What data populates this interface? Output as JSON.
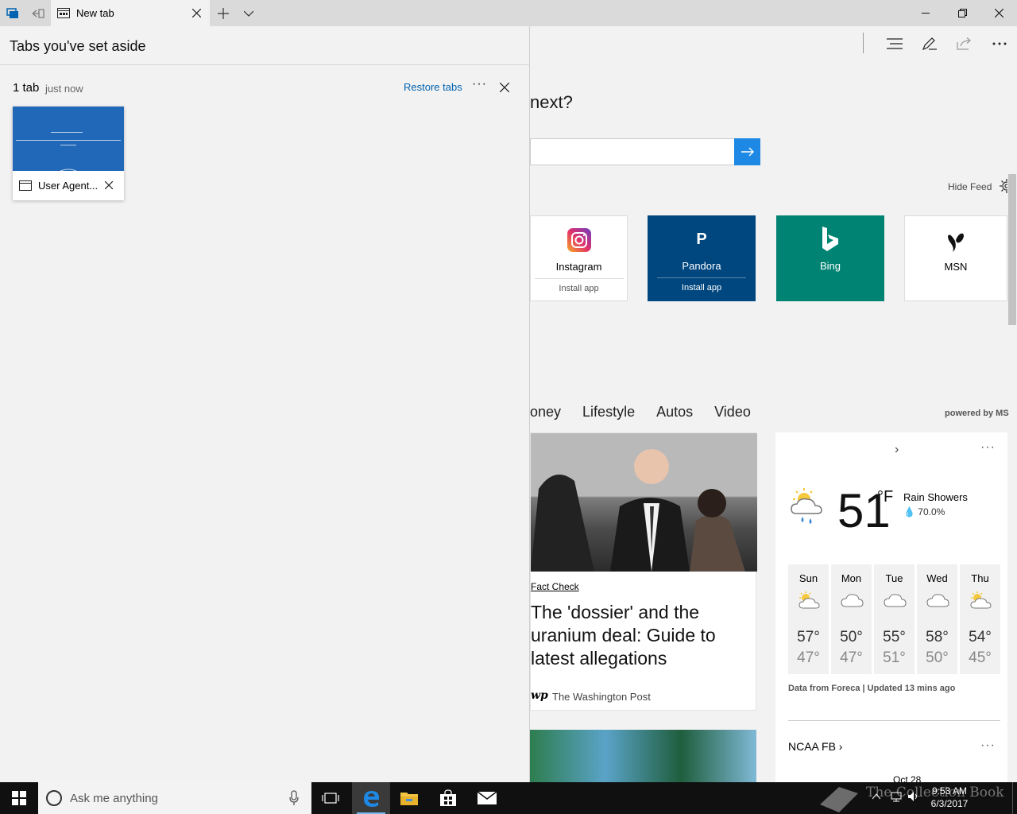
{
  "titlebar": {
    "tab_label": "New tab"
  },
  "toolbar": {
    "icons": [
      "hub-icon",
      "pen-icon",
      "share-icon",
      "more-icon"
    ]
  },
  "page": {
    "headline_fragment": "next?",
    "hide_feed": "Hide Feed",
    "tiles": [
      {
        "name": "Instagram",
        "install": "Install app"
      },
      {
        "name": "Pandora",
        "install": "Install app",
        "logo_text": "P"
      },
      {
        "name": "Bing"
      },
      {
        "name": "MSN"
      }
    ],
    "categories": [
      "oney",
      "Lifestyle",
      "Autos",
      "Video"
    ],
    "powered_by": "powered by MS",
    "news": {
      "tag": "Fact Check",
      "title": "The 'dossier' and the uranium deal: Guide to latest allegations",
      "source": "The Washington Post",
      "source_mark": "wp"
    },
    "weather": {
      "temp": "51",
      "unit": "°F",
      "condition": "Rain Showers",
      "precip": "70.0%",
      "days": [
        {
          "name": "Sun",
          "hi": "57°",
          "lo": "47°",
          "icon": "partly-sunny-icon"
        },
        {
          "name": "Mon",
          "hi": "50°",
          "lo": "47°",
          "icon": "cloud-icon"
        },
        {
          "name": "Tue",
          "hi": "55°",
          "lo": "51°",
          "icon": "cloud-icon"
        },
        {
          "name": "Wed",
          "hi": "58°",
          "lo": "50°",
          "icon": "cloud-icon"
        },
        {
          "name": "Thu",
          "hi": "54°",
          "lo": "45°",
          "icon": "partly-sunny-icon"
        }
      ],
      "data_source": "Data from Foreca | Updated 13 mins ago",
      "chevron": "›",
      "more": "···"
    },
    "sports": {
      "title": "NCAA FB ›",
      "more": "···",
      "date": "Oct 28"
    }
  },
  "aside_panel": {
    "title": "Tabs you've set aside",
    "group_count": "1 tab",
    "group_time": "just now",
    "restore": "Restore tabs",
    "more": "···",
    "tab_title": "User Agent..."
  },
  "taskbar": {
    "search_placeholder": "Ask me anything",
    "time": "9:53 AM",
    "date": "6/3/2017",
    "watermark": "The Collection Book"
  },
  "colors": {
    "accent": "#0063b1",
    "pandora": "#00467f",
    "bing": "#008373",
    "search_go": "#1e88e5",
    "thumb": "#2168b8"
  }
}
